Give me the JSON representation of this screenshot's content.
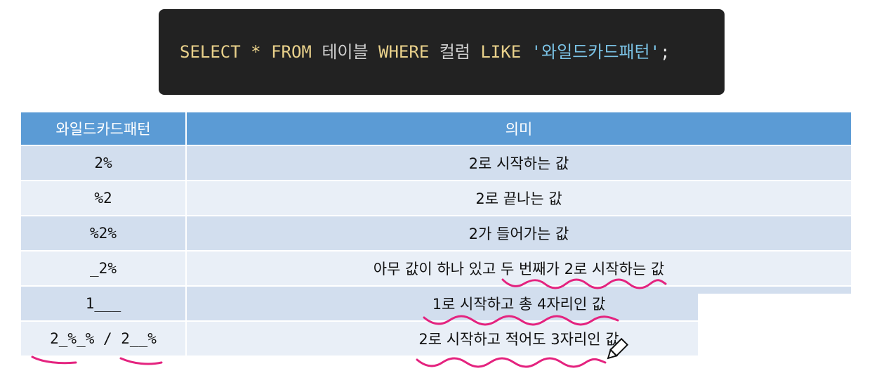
{
  "sql": {
    "select": "SELECT",
    "star": "*",
    "from": "FROM",
    "table": "테이블",
    "where": "WHERE",
    "column": "컬럼",
    "like": "LIKE",
    "pattern": "'와일드카드패턴'",
    "semicolon": ";"
  },
  "table": {
    "headers": [
      "와일드카드패턴",
      "의미"
    ],
    "rows": [
      {
        "pattern": "2%",
        "meaning": "2로 시작하는 값"
      },
      {
        "pattern": "%2",
        "meaning": "2로 끝나는 값"
      },
      {
        "pattern": "%2%",
        "meaning": "2가 들어가는 값"
      },
      {
        "pattern": "_2%",
        "meaning": "아무 값이 하나 있고 두 번째가 2로 시작하는 값"
      },
      {
        "pattern": "1___",
        "meaning": "1로 시작하고 총 4자리인 값"
      },
      {
        "pattern": "2_%_% / 2__%",
        "meaning": "2로 시작하고 적어도 3자리인 값"
      }
    ]
  },
  "colors": {
    "code_bg": "#222222",
    "keyword": "#e9d18b",
    "string": "#7bc3e6",
    "header_bg": "#5b9bd5",
    "row_dark": "#d2deee",
    "row_light": "#e9eff7",
    "annotation": "#e4237f"
  }
}
